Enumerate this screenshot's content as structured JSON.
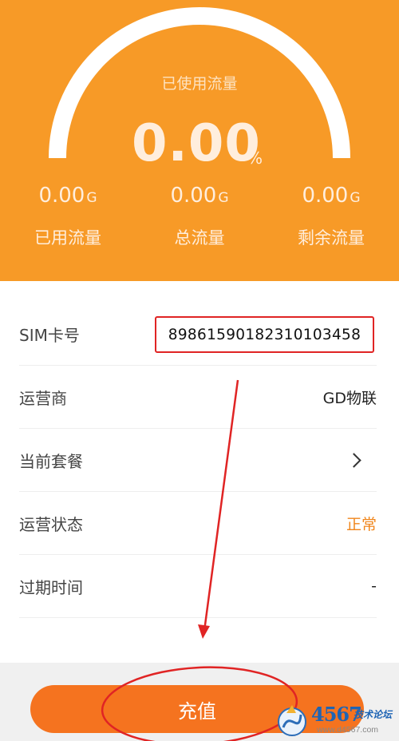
{
  "gauge": {
    "title": "已使用流量",
    "percent_value": "0.00",
    "percent_unit": "%"
  },
  "stats": [
    {
      "value": "0.00",
      "unit": "G",
      "label": "已用流量"
    },
    {
      "value": "0.00",
      "unit": "G",
      "label": "总流量"
    },
    {
      "value": "0.00",
      "unit": "G",
      "label": "剩余流量"
    }
  ],
  "info_rows": [
    {
      "label": "SIM卡号",
      "value": "89861590182310103458"
    },
    {
      "label": "运营商",
      "value": "GD物联"
    },
    {
      "label": "当前套餐",
      "value": ""
    },
    {
      "label": "运营状态",
      "value": "正常"
    },
    {
      "label": "过期时间",
      "value": "-"
    }
  ],
  "button": {
    "label": "充值"
  },
  "watermark": {
    "digits": "4567",
    "text": "技术论坛",
    "url": "www.d4567.com"
  },
  "colors": {
    "header": "#f79a27",
    "button": "#f5731f",
    "status": "#f0861c",
    "annotation": "#e02424"
  },
  "icons": {
    "chevron": "chevron-right-icon",
    "logo": "d4567-logo-icon"
  }
}
